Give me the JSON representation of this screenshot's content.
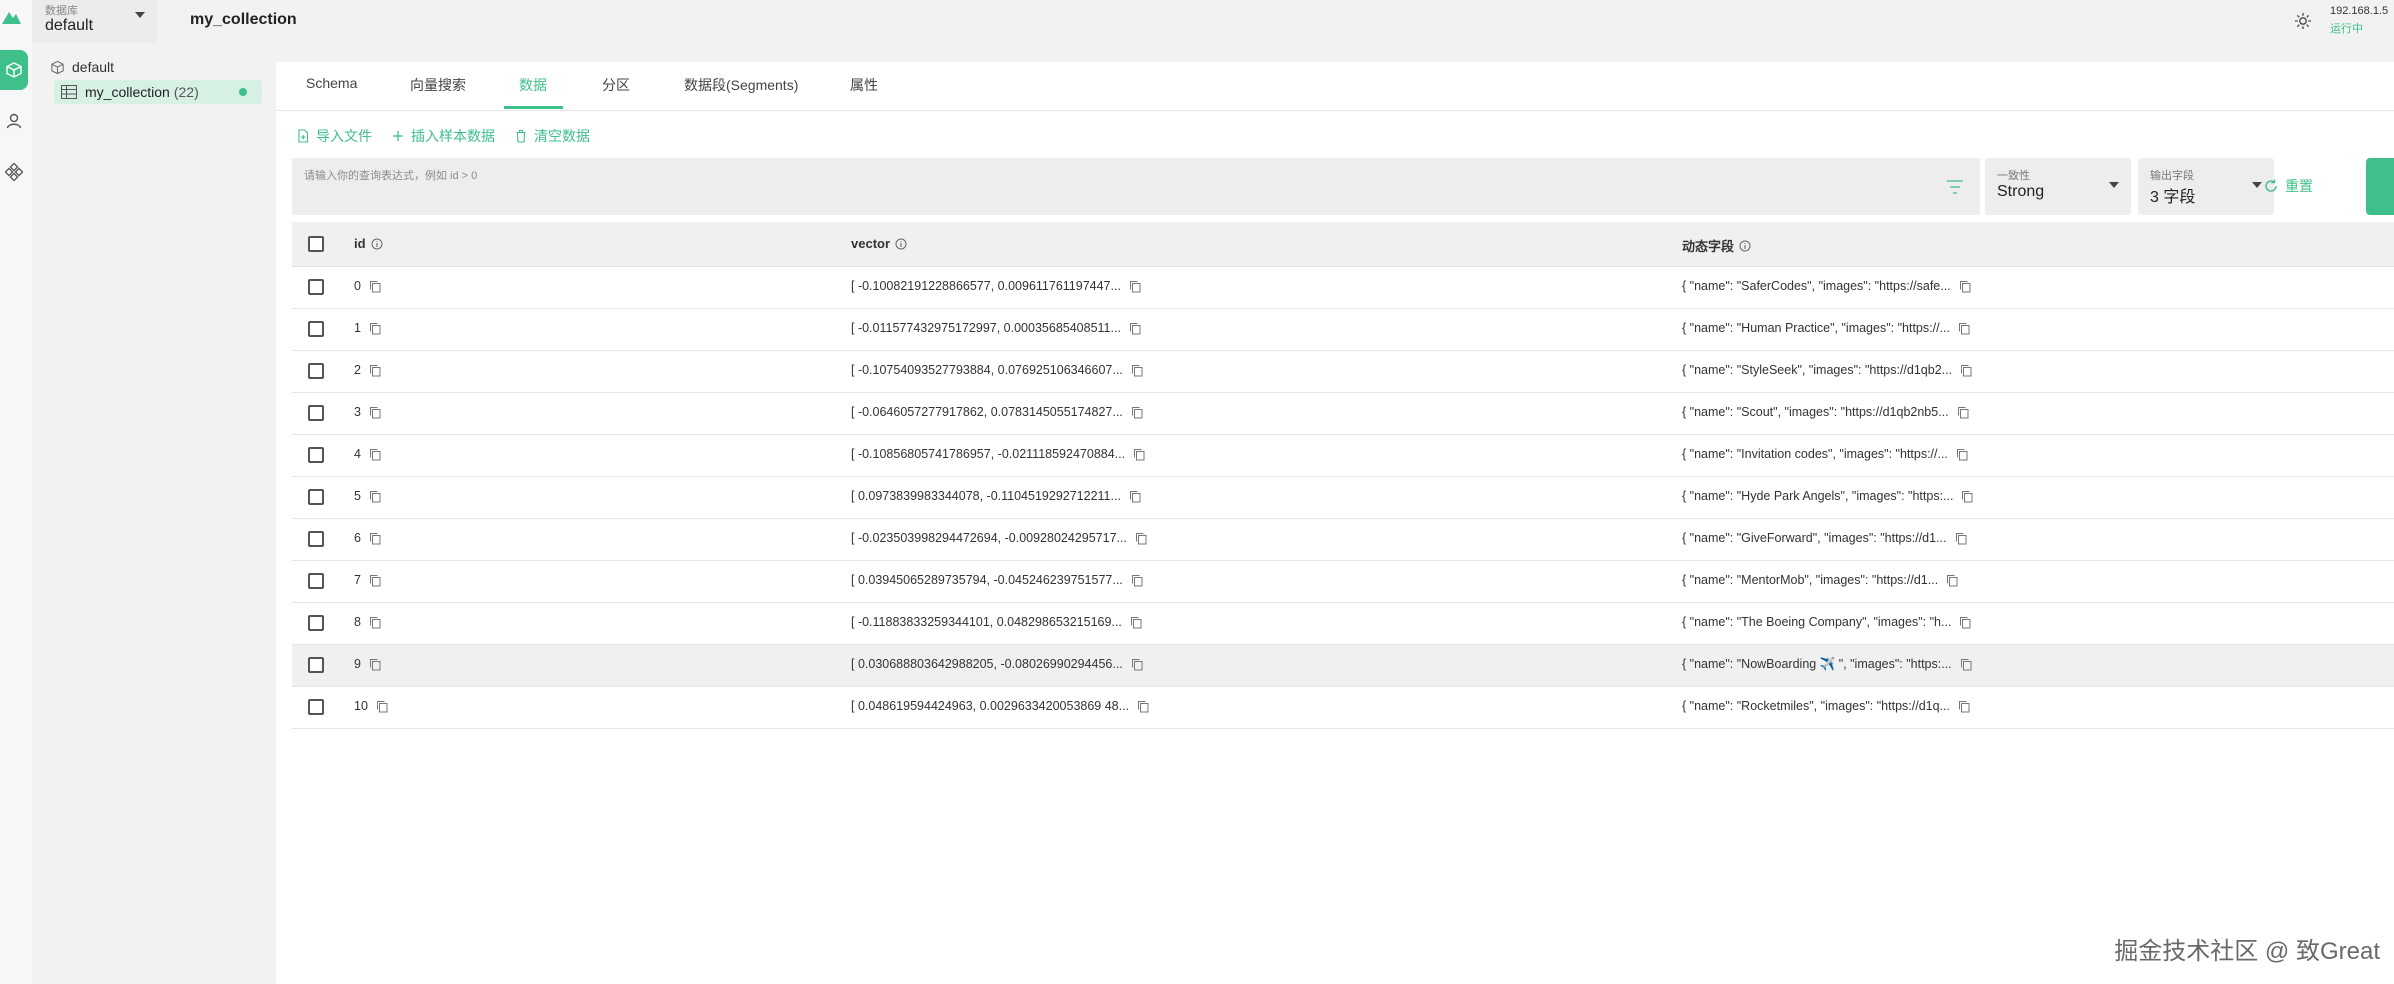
{
  "topbar": {
    "db_label": "数据库",
    "db_value": "default",
    "collection_title": "my_collection",
    "server_ip": "192.168.1.5",
    "server_status": "运行中"
  },
  "tree": {
    "root_label": "default",
    "collection_name": "my_collection",
    "collection_count": "(22)"
  },
  "tabs": [
    "Schema",
    "向量搜索",
    "数据",
    "分区",
    "数据段(Segments)",
    "属性"
  ],
  "toolbar": {
    "import_label": "导入文件",
    "insert_sample_label": "插入样本数据",
    "clear_label": "清空数据"
  },
  "query": {
    "placeholder": "请输入你的查询表达式，例如 id > 0"
  },
  "consistency": {
    "label": "一致性",
    "value": "Strong"
  },
  "output_fields": {
    "label": "输出字段",
    "value": "3 字段"
  },
  "reset_label": "重置",
  "table": {
    "headers": [
      "id",
      "vector",
      "动态字段"
    ],
    "rows": [
      {
        "id": "0",
        "vector": "[ -0.10082191228866577, 0.009611761197447...",
        "dynamic": "{ \"name\": \"SaferCodes\", \"images\": \"https://safe..."
      },
      {
        "id": "1",
        "vector": "[ -0.011577432975172997, 0.00035685408511...",
        "dynamic": "{ \"name\": \"Human Practice\", \"images\": \"https://..."
      },
      {
        "id": "2",
        "vector": "[ -0.10754093527793884, 0.076925106346607...",
        "dynamic": "{ \"name\": \"StyleSeek\", \"images\": \"https://d1qb2..."
      },
      {
        "id": "3",
        "vector": "[ -0.0646057277917862, 0.0783145055174827...",
        "dynamic": "{ \"name\": \"Scout\", \"images\": \"https://d1qb2nb5..."
      },
      {
        "id": "4",
        "vector": "[ -0.10856805741786957, -0.021118592470884...",
        "dynamic": "{ \"name\": \"Invitation codes\", \"images\": \"https://..."
      },
      {
        "id": "5",
        "vector": "[ 0.0973839983344078, -0.1104519292712211...",
        "dynamic": "{ \"name\": \"Hyde Park Angels\", \"images\": \"https:..."
      },
      {
        "id": "6",
        "vector": "[ -0.023503998294472694, -0.00928024295717...",
        "dynamic": "{ \"name\": \"GiveForward\", \"images\": \"https://d1..."
      },
      {
        "id": "7",
        "vector": "[ 0.03945065289735794, -0.045246239751577...",
        "dynamic": "{ \"name\": \"MentorMob\", \"images\": \"https://d1..."
      },
      {
        "id": "8",
        "vector": "[ -0.11883833259344101, 0.048298653215169...",
        "dynamic": "{ \"name\": \"The Boeing Company\", \"images\": \"h..."
      },
      {
        "id": "9",
        "vector": "[ 0.030688803642988205, -0.08026990294456...",
        "dynamic": "{ \"name\": \"NowBoarding ✈️ \", \"images\": \"https:..."
      },
      {
        "id": "10",
        "vector": "[ 0.048619594424963, 0.0029633420053869 48...",
        "dynamic": "{ \"name\": \"Rocketmiles\", \"images\": \"https://d1q..."
      }
    ]
  },
  "watermark": "掘金技术社区 @ 致Great",
  "colors": {
    "accent": "#3fbf8a",
    "background": "#f2f2f2"
  }
}
